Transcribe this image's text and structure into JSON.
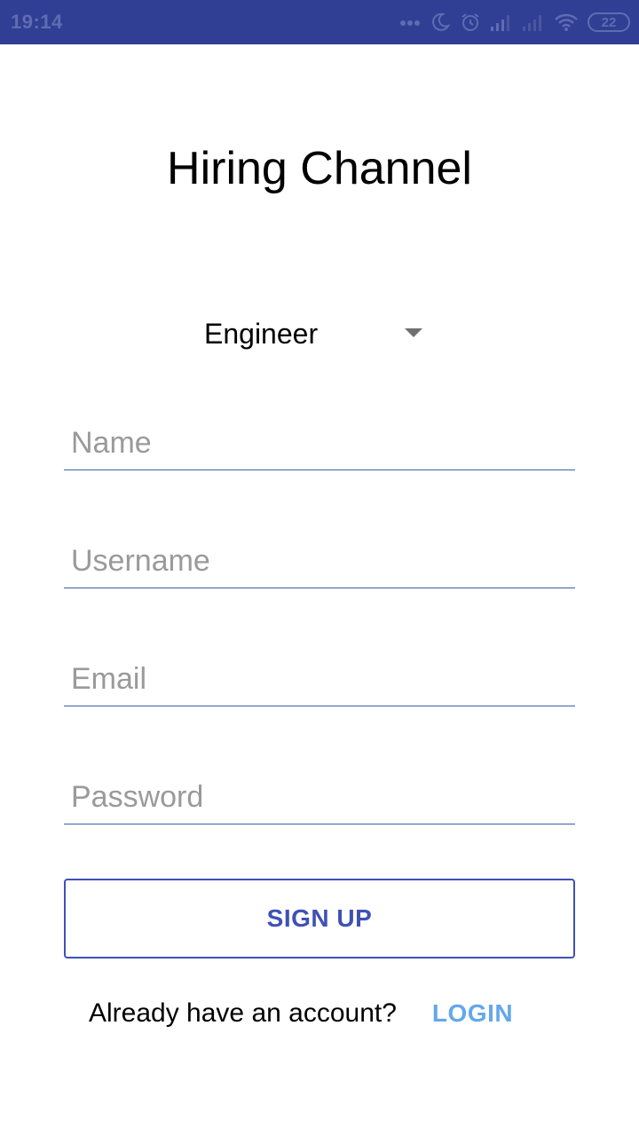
{
  "status_bar": {
    "time": "19:14",
    "battery": "22",
    "icons": [
      "dots-icon",
      "moon-icon",
      "alarm-icon",
      "signal-icon",
      "signal-icon",
      "wifi-icon",
      "battery-icon"
    ],
    "color": "#303f94"
  },
  "app": {
    "title": "Hiring Channel"
  },
  "role_select": {
    "value": "Engineer",
    "icon": "dropdown-arrow-icon"
  },
  "form": {
    "name_placeholder": "Name",
    "username_placeholder": "Username",
    "email_placeholder": "Email",
    "password_placeholder": "Password",
    "signup_label": "SIGN UP",
    "accent_color": "#3f51b5"
  },
  "login": {
    "question": "Already have an account?",
    "link_label": "LOGIN",
    "link_color": "#64a8ea"
  }
}
